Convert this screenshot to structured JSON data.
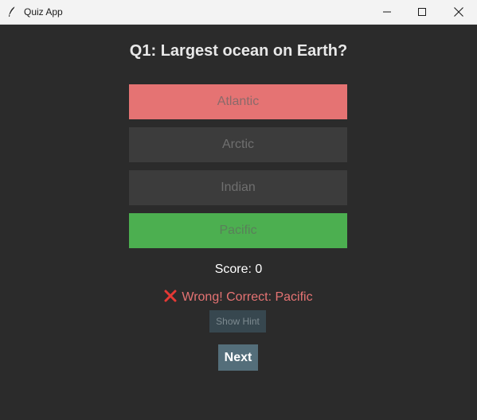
{
  "window": {
    "title": "Quiz App",
    "icon": "feather-icon",
    "controls": [
      "minimize-icon",
      "maximize-icon",
      "close-icon"
    ]
  },
  "quiz": {
    "question": "Q1: Largest ocean on Earth?",
    "options": [
      {
        "label": "Atlantic",
        "state": "wrong-selected",
        "color": "#e57373"
      },
      {
        "label": "Arctic",
        "state": "disabled",
        "color": "#3c3c3c"
      },
      {
        "label": "Indian",
        "state": "disabled",
        "color": "#3c3c3c"
      },
      {
        "label": "Pacific",
        "state": "correct",
        "color": "#4caf50"
      }
    ],
    "score": "Score: 0",
    "feedback": "Wrong! Correct: Pacific",
    "feedback_icon": "cross-mark-icon",
    "hint_label": "Show Hint",
    "next_label": "Next"
  },
  "colors": {
    "background": "#2b2b2b",
    "wrong": "#e57373",
    "correct": "#4caf50",
    "next_button": "#546e7a",
    "hint_button": "#37474f"
  }
}
